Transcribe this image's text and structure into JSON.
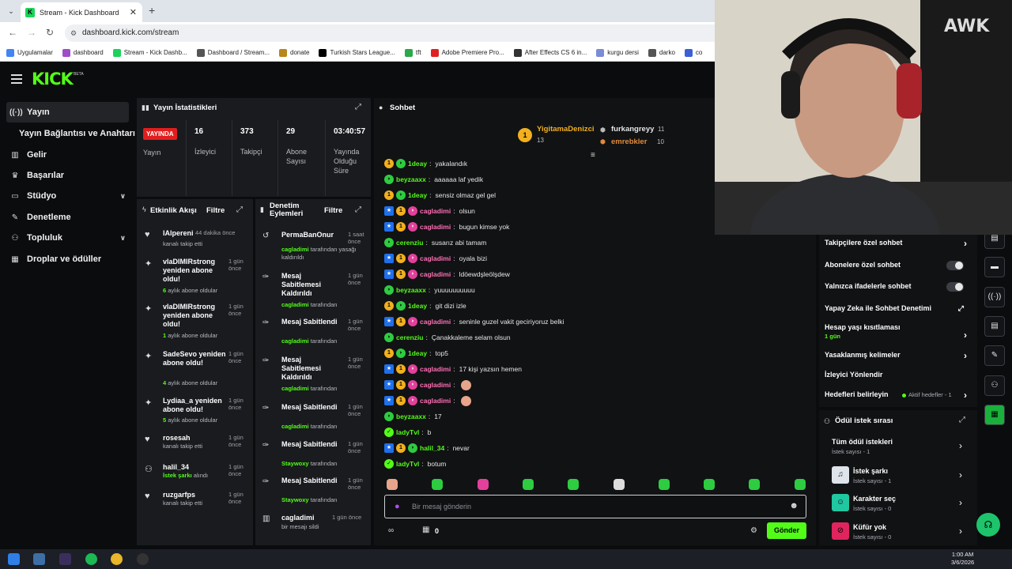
{
  "browser": {
    "tab_title": "Stream - Kick Dashboard",
    "url": "dashboard.kick.com/stream",
    "bookmarks": [
      "Uygulamalar",
      "dashboard",
      "Stream - Kick Dashb...",
      "Dashboard / Stream...",
      "donate",
      "Turkish Stars League...",
      "tft",
      "Adobe Premiere Pro...",
      "After Effects CS 6 in...",
      "kurgu dersi",
      "darko",
      "co"
    ]
  },
  "brand": {
    "logo": "KICK",
    "beta": "BETA"
  },
  "sidebar": {
    "items": [
      {
        "label": "Yayın",
        "icon": "broadcast-icon"
      },
      {
        "label": "Yayın Bağlantısı ve Anahtarı",
        "icon": ""
      },
      {
        "label": "Gelir",
        "icon": "chart-icon"
      },
      {
        "label": "Başarılar",
        "icon": "trophy-icon"
      },
      {
        "label": "Stüdyo",
        "icon": "studio-icon"
      },
      {
        "label": "Denetleme",
        "icon": "wrench-icon"
      },
      {
        "label": "Topluluk",
        "icon": "people-icon"
      },
      {
        "label": "Droplar ve ödüller",
        "icon": "gift-icon"
      }
    ]
  },
  "stats": {
    "title": "Yayın İstatistikleri",
    "live_label": "YAYINDA",
    "live_sub": "Yayın",
    "cells": [
      {
        "value": "16",
        "label": "İzleyici"
      },
      {
        "value": "373",
        "label": "Takipçi"
      },
      {
        "value": "29",
        "label": "Abone Sayısı"
      },
      {
        "value": "03:40:57",
        "label": "Yayında Olduğu Süre"
      }
    ]
  },
  "activity": {
    "title": "Etkinlik Akışı",
    "filter": "Filtre",
    "items": [
      {
        "name": "lAlpereni",
        "time": "44 dakika önce",
        "sub": "kanalı takip etti"
      },
      {
        "name": "vlaDIMIRstrong yeniden abone oldu!",
        "time": "1 gün önce",
        "num": "6",
        "sub": " aylık abone oldular"
      },
      {
        "name": "vlaDIMIRstrong yeniden abone oldu!",
        "time": "1 gün önce",
        "num": "1",
        "sub": " aylık abone oldular"
      },
      {
        "name": "SadeSevo yeniden abone oldu!",
        "time": "1 gün önce",
        "num": "4",
        "sub": " aylık abone oldular"
      },
      {
        "name": "Lydiaa_a yeniden abone oldu!",
        "time": "1 gün önce",
        "num": "5",
        "sub": " aylık abone oldular"
      },
      {
        "name": "rosesah",
        "time": "1 gün önce",
        "sub": "kanalı takip etti"
      },
      {
        "name": "halil_34",
        "time": "1 gün önce",
        "num": "İstek şarkı",
        "sub": " alındı"
      },
      {
        "name": "ruzgarfps",
        "time": "1 gün önce",
        "sub": "kanalı takip etti"
      }
    ]
  },
  "moderation": {
    "title": "Denetim Eylemleri",
    "filter": "Filtre",
    "items": [
      {
        "name": "PermaBanOnur",
        "time": "1 saat önce",
        "by": "cagladimi",
        "sub": " tarafından yasağı kaldırıldı"
      },
      {
        "name": "Mesaj Sabitlemesi Kaldırıldı",
        "time": "1 gün önce",
        "by": "cagladimi",
        "sub": " tarafından"
      },
      {
        "name": "Mesaj Sabitlendi",
        "time": "1 gün önce",
        "by": "cagladimi",
        "sub": " tarafından"
      },
      {
        "name": "Mesaj Sabitlemesi Kaldırıldı",
        "time": "1 gün önce",
        "by": "cagladimi",
        "sub": " tarafından"
      },
      {
        "name": "Mesaj Sabitlendi",
        "time": "1 gün önce",
        "by": "cagladimi",
        "sub": " tarafından"
      },
      {
        "name": "Mesaj Sabitlendi",
        "time": "1 gün önce",
        "by": "Staywoxy",
        "sub": " tarafından"
      },
      {
        "name": "Mesaj Sabitlendi",
        "time": "1 gün önce",
        "by": "Staywoxy",
        "sub": " tarafından"
      },
      {
        "name": "cagladimi",
        "time": "1 gün önce",
        "by": "",
        "sub": "bir mesajı sildi"
      }
    ]
  },
  "chat": {
    "title": "Sohbet",
    "top_gifters": [
      {
        "name": "YigitamaDenizci",
        "count": "13"
      },
      {
        "name": "furkangreyy",
        "count": "11"
      },
      {
        "name": "emrebkler",
        "count": "10"
      }
    ],
    "messages": [
      {
        "user": "1deay",
        "text": "yakalandık",
        "badges": [
          "gold",
          "green"
        ],
        "color": "#53fc18"
      },
      {
        "user": "beyzaaxx",
        "text": "aaaaaa laf yedik",
        "badges": [
          "green"
        ],
        "color": "#53fc18"
      },
      {
        "user": "1deay",
        "text": "sensiz olmaz gel gel",
        "badges": [
          "gold",
          "green"
        ],
        "color": "#53fc18"
      },
      {
        "user": "cagladimi",
        "text": "olsun",
        "badges": [
          "blue",
          "gold",
          "pink"
        ],
        "color": "#ff6fb5"
      },
      {
        "user": "cagladimi",
        "text": "bugun kimse yok",
        "badges": [
          "blue",
          "gold",
          "pink"
        ],
        "color": "#ff6fb5"
      },
      {
        "user": "cerenziu",
        "text": "susarız abi tamam",
        "badges": [
          "green"
        ],
        "color": "#53fc18"
      },
      {
        "user": "cagladimi",
        "text": "oyala bizi",
        "badges": [
          "blue",
          "gold",
          "pink"
        ],
        "color": "#ff6fb5"
      },
      {
        "user": "cagladimi",
        "text": "ldöewdşleölşdew",
        "badges": [
          "blue",
          "gold",
          "pink"
        ],
        "color": "#ff6fb5"
      },
      {
        "user": "beyzaaxx",
        "text": "yuuuuuuuuuu",
        "badges": [
          "green"
        ],
        "color": "#53fc18"
      },
      {
        "user": "1deay",
        "text": "git dizi izle",
        "badges": [
          "gold",
          "green"
        ],
        "color": "#53fc18"
      },
      {
        "user": "cagladimi",
        "text": "seninle guzel vakit geciriyoruz belki",
        "badges": [
          "blue",
          "gold",
          "pink"
        ],
        "color": "#ff6fb5"
      },
      {
        "user": "cerenziu",
        "text": "Çanakkaleme selam olsun",
        "badges": [
          "green"
        ],
        "color": "#53fc18"
      },
      {
        "user": "1deay",
        "text": "top5",
        "badges": [
          "gold",
          "green"
        ],
        "color": "#53fc18"
      },
      {
        "user": "cagladimi",
        "text": "17 kişi yazsın hemen",
        "badges": [
          "blue",
          "gold",
          "pink"
        ],
        "color": "#ff6fb5"
      },
      {
        "user": "cagladimi",
        "text": "",
        "emote": true,
        "badges": [
          "blue",
          "gold",
          "pink"
        ],
        "color": "#ff6fb5"
      },
      {
        "user": "cagladimi",
        "text": "",
        "emote": true,
        "badges": [
          "blue",
          "gold",
          "pink"
        ],
        "color": "#ff6fb5"
      },
      {
        "user": "beyzaaxx",
        "text": "17",
        "badges": [
          "green"
        ],
        "color": "#53fc18"
      },
      {
        "user": "ladyTvl",
        "text": "b",
        "badges": [
          "lime"
        ],
        "color": "#53fc18"
      },
      {
        "user": "halil_34",
        "text": "nevar",
        "badges": [
          "blue",
          "gold",
          "green"
        ],
        "color": "#53fc18"
      },
      {
        "user": "ladyTvl",
        "text": "botum",
        "badges": [
          "lime"
        ],
        "color": "#53fc18"
      }
    ],
    "input_placeholder": "Bir mesaj gönderin",
    "send_label": "Gönder",
    "points": "0"
  },
  "settings": {
    "items": [
      {
        "label": "Takipçilere özel sohbet",
        "type": "chevron"
      },
      {
        "label": "Abonelere özel sohbet",
        "type": "toggle"
      },
      {
        "label": "Yalnızca ifadelerle sohbet",
        "type": "toggle"
      },
      {
        "label": "Yapay Zeka ile Sohbet Denetimi",
        "type": "link"
      },
      {
        "label": "Hesap yaşı kısıtlaması",
        "sub": "1 gün",
        "type": "chevron"
      },
      {
        "label": "Yasaklanmış kelimeler",
        "type": "chevron"
      },
      {
        "label": "İzleyici Yönlendir",
        "type": "none"
      },
      {
        "label": "Hedefleri belirleyin",
        "extra": "Aktif hedefler - 1",
        "type": "chevron"
      }
    ]
  },
  "rewards": {
    "title": "Ödül istek sırası",
    "items": [
      {
        "title": "Tüm ödül istekleri",
        "sub": "İstek sayısı - 1",
        "icon": "",
        "color": ""
      },
      {
        "title": "İstek şarkı",
        "sub": "İstek sayısı - 1",
        "icon": "music-icon",
        "color": "#dfe3ea"
      },
      {
        "title": "Karakter seç",
        "sub": "İstek sayısı - 0",
        "icon": "character-icon",
        "color": "#1fc8a0"
      },
      {
        "title": "Küfür yok",
        "sub": "İstek sayısı - 0",
        "icon": "no-swear-icon",
        "color": "#e0245e"
      }
    ]
  },
  "taskbar": {
    "time": "1:00 AM",
    "date": "3/6/2026"
  }
}
